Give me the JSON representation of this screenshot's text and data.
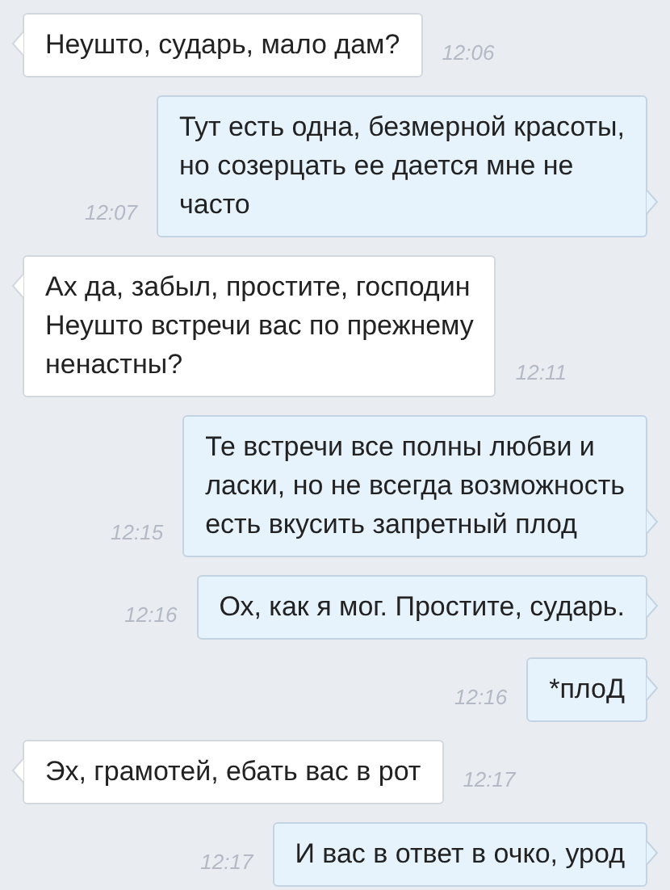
{
  "messages": [
    {
      "kind": "in",
      "text": "Неушто, сударь, мало дам?",
      "time": "12:06"
    },
    {
      "kind": "out",
      "text": "Тут есть одна, безмерной красоты,\nно созерцать ее дается мне не\nчасто",
      "time": "12:07"
    },
    {
      "kind": "in",
      "text": "Ах да, забыл, простите, господин\nНеушто встречи вас по прежнему\nненастны?",
      "time": "12:11"
    },
    {
      "kind": "out",
      "text": "Те встречи все полны любви и\nласки, но не всегда возможность\nесть вкусить запретный плод",
      "time": "12:15"
    },
    {
      "kind": "out",
      "text": "Ох, как я мог. Простите, сударь.",
      "time": "12:16"
    },
    {
      "kind": "out",
      "text": "*плоД",
      "time": "12:16"
    },
    {
      "kind": "in",
      "text": "Эх, грамотей, ебать вас в рот",
      "time": "12:17"
    },
    {
      "kind": "out",
      "text": "И вас в ответ в очко, урод",
      "time": "12:17"
    }
  ]
}
